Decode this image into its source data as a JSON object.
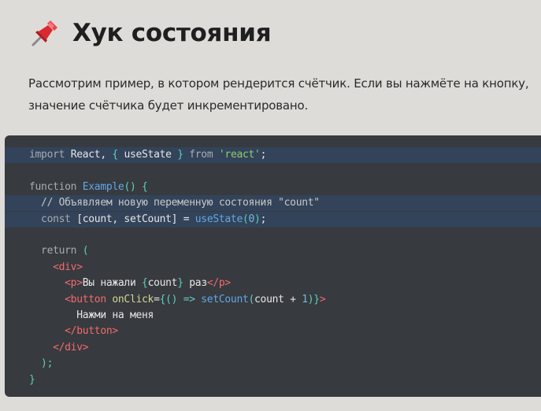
{
  "heading": {
    "icon": "pushpin-icon",
    "title": "Хук состояния"
  },
  "intro": {
    "line1": "Рассмотрим пример, в котором рендерится счётчик. Если вы нажмёте на кнопку,",
    "line2": "значение счётчика будет инкрементировано."
  },
  "code": {
    "highlight_color": "#33435a",
    "background_color": "#373a3f",
    "lines": [
      {
        "highlight": true,
        "tokens": [
          [
            "kw",
            "import "
          ],
          [
            "op",
            "React, "
          ],
          [
            "brk",
            "{ "
          ],
          [
            "op",
            "useState "
          ],
          [
            "brk",
            "}"
          ],
          [
            "kw",
            " from "
          ],
          [
            "str",
            "'react'"
          ],
          [
            "op",
            ";"
          ]
        ]
      },
      {
        "highlight": false,
        "tokens": []
      },
      {
        "highlight": false,
        "tokens": [
          [
            "kw",
            "function "
          ],
          [
            "fn",
            "Example"
          ],
          [
            "brk",
            "() {"
          ]
        ]
      },
      {
        "highlight": true,
        "tokens": [
          [
            "cm",
            "  // Объявляем новую переменную состояния \"count\""
          ]
        ]
      },
      {
        "highlight": true,
        "tokens": [
          [
            "kw",
            "  const "
          ],
          [
            "op",
            "[count, setCount] = "
          ],
          [
            "fn",
            "useState"
          ],
          [
            "brk",
            "("
          ],
          [
            "num",
            "0"
          ],
          [
            "brk",
            ")"
          ],
          [
            "op",
            ";"
          ]
        ]
      },
      {
        "highlight": false,
        "tokens": []
      },
      {
        "highlight": false,
        "tokens": [
          [
            "kw",
            "  return "
          ],
          [
            "brk",
            "("
          ]
        ]
      },
      {
        "highlight": false,
        "tokens": [
          [
            "tag",
            "    <div>"
          ]
        ]
      },
      {
        "highlight": false,
        "tokens": [
          [
            "tag",
            "      <p>"
          ],
          [
            "op",
            "Вы нажали "
          ],
          [
            "brk",
            "{"
          ],
          [
            "op",
            "count"
          ],
          [
            "brk",
            "}"
          ],
          [
            "op",
            " раз"
          ],
          [
            "tag",
            "</p>"
          ]
        ]
      },
      {
        "highlight": false,
        "tokens": [
          [
            "tag",
            "      <button "
          ],
          [
            "attr",
            "onClick"
          ],
          [
            "op",
            "="
          ],
          [
            "brk",
            "{() => "
          ],
          [
            "fn",
            "setCount"
          ],
          [
            "brk",
            "("
          ],
          [
            "op",
            "count + "
          ],
          [
            "num",
            "1"
          ],
          [
            "brk",
            ")}"
          ],
          [
            "tag",
            ">"
          ]
        ]
      },
      {
        "highlight": false,
        "tokens": [
          [
            "op",
            "        Нажми на меня"
          ]
        ]
      },
      {
        "highlight": false,
        "tokens": [
          [
            "tag",
            "      </button>"
          ]
        ]
      },
      {
        "highlight": false,
        "tokens": [
          [
            "tag",
            "    </div>"
          ]
        ]
      },
      {
        "highlight": false,
        "tokens": [
          [
            "brk",
            "  );"
          ]
        ]
      },
      {
        "highlight": false,
        "tokens": [
          [
            "brk",
            "}"
          ]
        ]
      }
    ]
  }
}
